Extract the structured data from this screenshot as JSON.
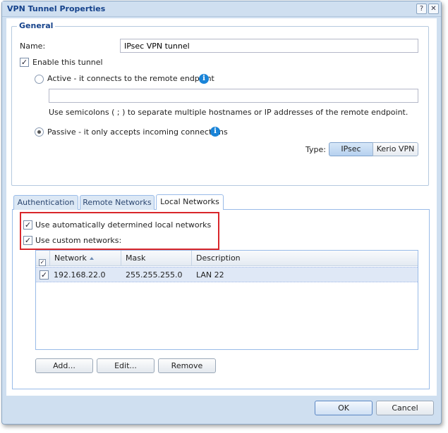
{
  "window": {
    "title": "VPN Tunnel Properties",
    "help_glyph": "?",
    "close_glyph": "✕"
  },
  "general": {
    "legend": "General",
    "name_label": "Name:",
    "name_value": "IPsec VPN tunnel",
    "enable_label": "Enable this tunnel",
    "enable_checked": true,
    "active_label": "Active - it connects to the remote endpoint",
    "active_selected": false,
    "remote_endpoint_value": "",
    "hint": "Use semicolons ( ; ) to separate multiple hostnames or IP addresses of the remote endpoint.",
    "passive_label": "Passive - it only accepts incoming connections",
    "passive_selected": true,
    "info_glyph": "i",
    "type_label": "Type:",
    "type_options": [
      "IPsec",
      "Kerio VPN"
    ],
    "type_selected": "IPsec"
  },
  "tabs": [
    {
      "label": "Authentication",
      "active": false
    },
    {
      "label": "Remote Networks",
      "active": false
    },
    {
      "label": "Local Networks",
      "active": true
    }
  ],
  "local_networks": {
    "auto_label": "Use automatically determined local networks",
    "auto_checked": true,
    "custom_label": "Use custom networks:",
    "custom_checked": true,
    "grid": {
      "columns": [
        "Network",
        "Mask",
        "Description"
      ],
      "sorted_column": "Network",
      "sort_direction": "ascending",
      "rows": [
        {
          "checked": true,
          "network": "192.168.22.0",
          "mask": "255.255.255.0",
          "description": "LAN 22"
        }
      ]
    },
    "buttons": {
      "add": "Add...",
      "edit": "Edit...",
      "remove": "Remove"
    }
  },
  "footer": {
    "ok": "OK",
    "cancel": "Cancel"
  },
  "colors": {
    "highlight_box": "#d9262b",
    "selected_row": "#dfe8f6",
    "title_text": "#15428b"
  }
}
